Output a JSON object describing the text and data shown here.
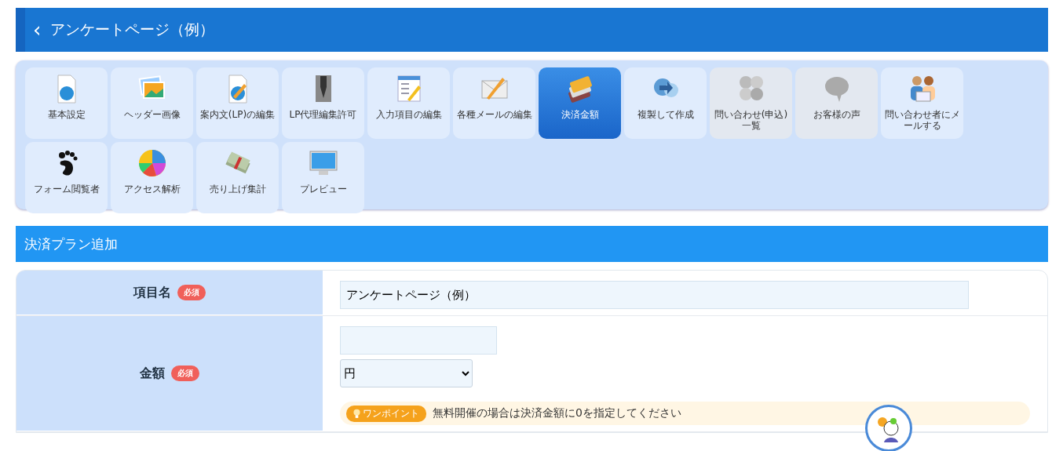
{
  "header": {
    "back": "‹",
    "title": "アンケートページ（例）"
  },
  "tools": [
    {
      "label": "基本設定",
      "kind": "doc-globe",
      "selected": false,
      "disabled": false
    },
    {
      "label": "ヘッダー画像",
      "kind": "photo",
      "selected": false,
      "disabled": false
    },
    {
      "label": "案内文(LP)の編集",
      "kind": "doc-pencil",
      "selected": false,
      "disabled": false
    },
    {
      "label": "LP代理編集許可",
      "kind": "pen",
      "selected": false,
      "disabled": false
    },
    {
      "label": "入力項目の編集",
      "kind": "form",
      "selected": false,
      "disabled": false
    },
    {
      "label": "各種メールの編集",
      "kind": "mail",
      "selected": false,
      "disabled": false
    },
    {
      "label": "決済金額",
      "kind": "cards",
      "selected": true,
      "disabled": false
    },
    {
      "label": "複製して作成",
      "kind": "sync",
      "selected": false,
      "disabled": false
    },
    {
      "label": "問い合わせ(申込)一覧",
      "kind": "bubbles",
      "selected": false,
      "disabled": true
    },
    {
      "label": "お客様の声",
      "kind": "bubble",
      "selected": false,
      "disabled": true
    },
    {
      "label": "問い合わせ者にメールする",
      "kind": "people",
      "selected": false,
      "disabled": false
    },
    {
      "label": "フォーム閲覧者",
      "kind": "foot",
      "selected": false,
      "disabled": false
    },
    {
      "label": "アクセス解析",
      "kind": "pie",
      "selected": false,
      "disabled": false
    },
    {
      "label": "売り上げ集計",
      "kind": "money",
      "selected": false,
      "disabled": false
    },
    {
      "label": "プレビュー",
      "kind": "monitor",
      "selected": false,
      "disabled": false
    }
  ],
  "section": {
    "title": "決済プラン追加"
  },
  "form": {
    "rows": [
      {
        "label": "項目名",
        "badge": "必須",
        "kind": "text",
        "value": "アンケートページ（例）"
      },
      {
        "label": "金額",
        "badge": "必須",
        "kind": "amount",
        "value": "",
        "select": "円",
        "tip_badge": "ワンポイント",
        "tip": "無料開催の場合は決済金額に0を指定してください"
      }
    ]
  }
}
